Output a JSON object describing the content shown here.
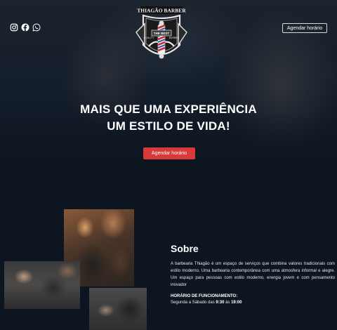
{
  "header": {
    "logo": {
      "brand": "THIAGÃO BARBER",
      "ribbon": "THE BEST",
      "left_badge": "QUALITY",
      "right_badge": "BARBER"
    },
    "social_icons": [
      "instagram-icon",
      "facebook-icon",
      "whatsapp-icon"
    ],
    "book_button_label": "Agendar horário"
  },
  "hero": {
    "headline_line1": "MAIS QUE UMA EXPERIÊNCIA",
    "headline_line2": "UM ESTILO DE VIDA!",
    "cta_label": "Agendar horário"
  },
  "about": {
    "title": "Sobre",
    "text": "A barbearia Thiagão é um espaço de serviços que combina valores tradicionais com estilo moderno. Uma barbearia contemporânea com uma atmosfera informal e alegre. Um espaço para pessoas com estilo moderno, energia jovem e com pensamento inovador",
    "hours_label": "HORÁRIO DE FUNCIONAMENTO:",
    "hours_prefix": "Segunda a Sábado das ",
    "hours_open": "9:30",
    "hours_join": " às ",
    "hours_close": "19:00"
  },
  "colors": {
    "background": "#0d1520",
    "accent": "#d63a3a",
    "text": "#ffffff"
  }
}
